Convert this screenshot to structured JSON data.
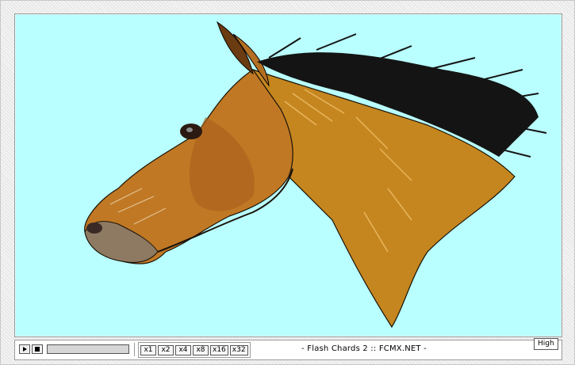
{
  "player": {
    "title": "- Flash Chards 2 :: FCMX.NET -",
    "quality_label": "High",
    "progress": 0,
    "speeds": [
      "x1",
      "x2",
      "x4",
      "x8",
      "x16",
      "x32"
    ],
    "background_color": "#b9ffff",
    "accent_colors": {
      "horse": "#c5861f",
      "mane": "#111111"
    },
    "icons": {
      "play": "play-icon",
      "stop": "stop-icon"
    }
  }
}
